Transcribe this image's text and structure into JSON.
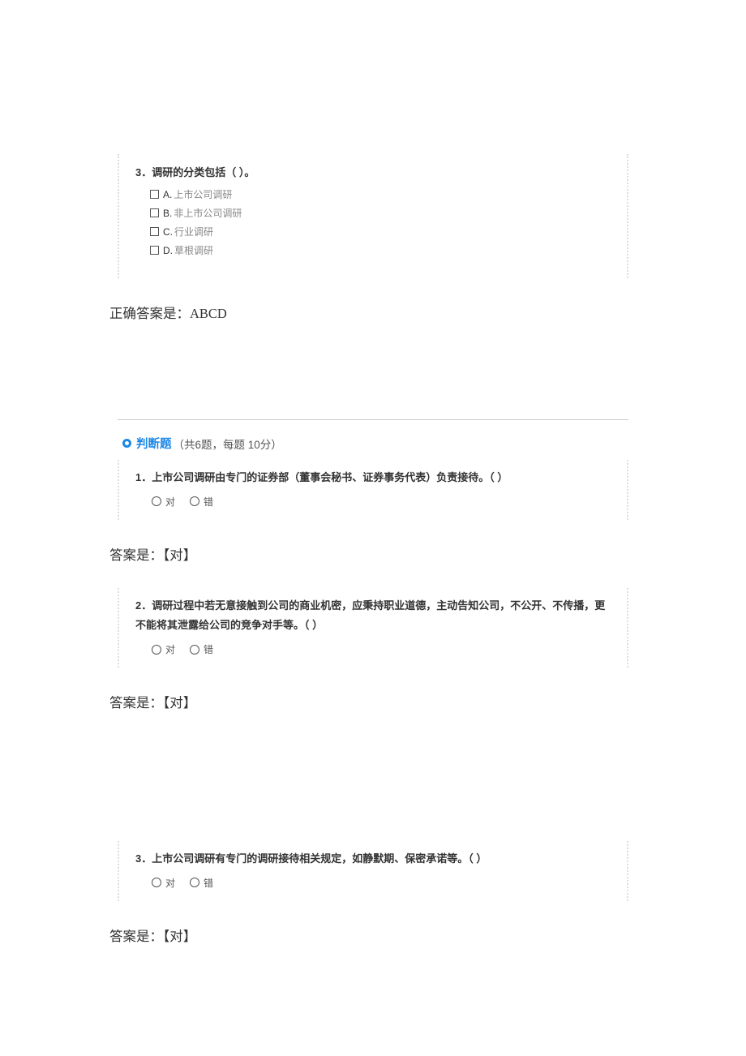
{
  "mc": {
    "q3": {
      "title": "3．调研的分类包括（  ）。",
      "opts": {
        "a_letter": "A.",
        "a_text": "上市公司调研",
        "b_letter": "B.",
        "b_text": "非上市公司调研",
        "c_letter": "C.",
        "c_text": "行业调研",
        "d_letter": "D.",
        "d_text": "草根调研"
      },
      "answer": "正确答案是：ABCD"
    }
  },
  "section": {
    "title": "判断题",
    "sub": "（共6题，每题 10分）"
  },
  "tf": {
    "true_label": "对",
    "false_label": "错",
    "q1": {
      "title": "1．上市公司调研由专门的证券部（董事会秘书、证券事务代表）负责接待。（ ）",
      "answer": "答案是：【对】"
    },
    "q2": {
      "title": "2．调研过程中若无意接触到公司的商业机密，应秉持职业道德，主动告知公司，不公开、不传播，更不能将其泄露给公司的竞争对手等。（ ）",
      "answer": "答案是：【对】"
    },
    "q3": {
      "title": "3．上市公司调研有专门的调研接待相关规定，如静默期、保密承诺等。（ ）",
      "answer": "答案是：【对】"
    }
  }
}
